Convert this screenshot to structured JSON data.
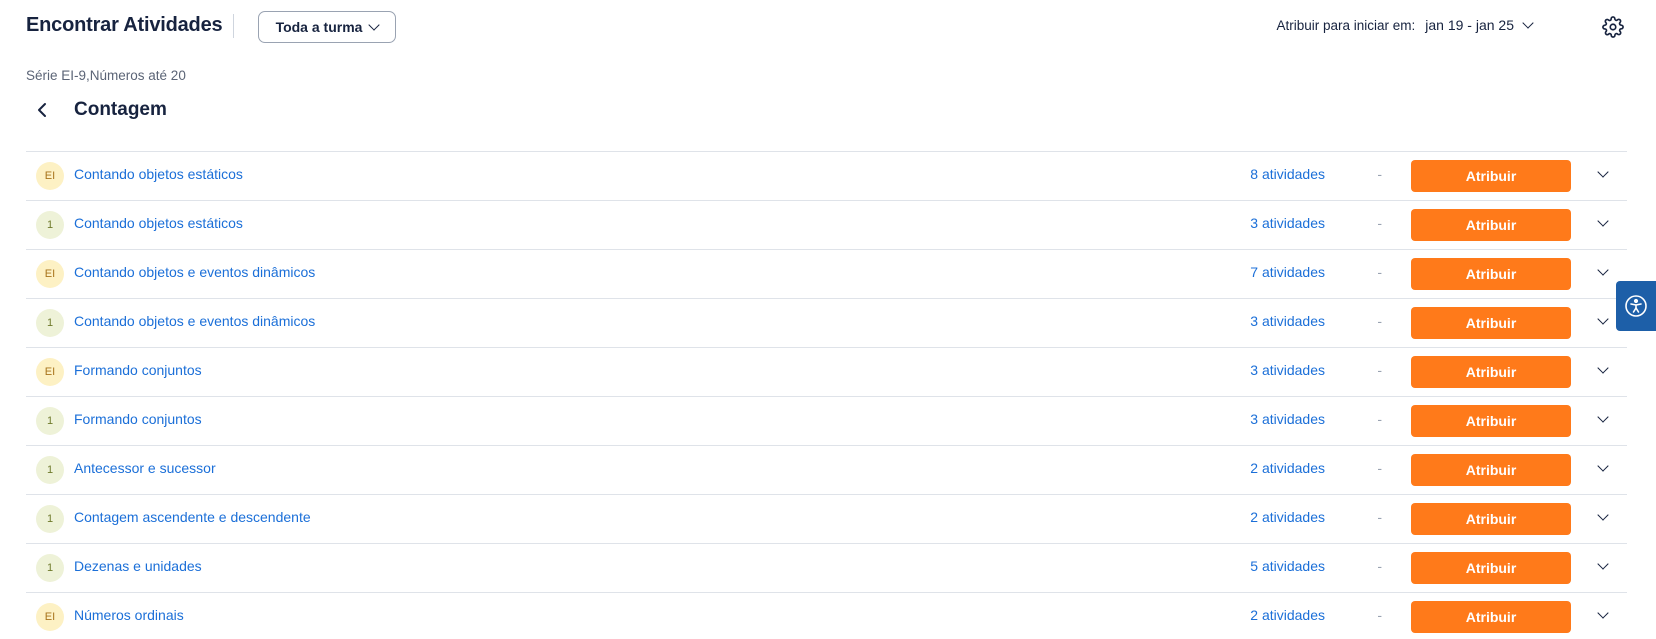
{
  "header": {
    "title": "Encontrar Atividades",
    "class_select": "Toda a turma",
    "assign_start_label": "Atribuir para iniciar em:",
    "date_range": "jan 19 - jan 25"
  },
  "breadcrumb": "Série EI-9,Números até 20",
  "page_title": "Contagem",
  "rows": [
    {
      "level": "EI",
      "title": "Contando objetos estáticos",
      "count": "8 atividades",
      "dash": "-",
      "button": "Atribuir"
    },
    {
      "level": "1",
      "title": "Contando objetos estáticos",
      "count": "3 atividades",
      "dash": "-",
      "button": "Atribuir"
    },
    {
      "level": "EI",
      "title": "Contando objetos e eventos dinâmicos",
      "count": "7 atividades",
      "dash": "-",
      "button": "Atribuir"
    },
    {
      "level": "1",
      "title": "Contando objetos e eventos dinâmicos",
      "count": "3 atividades",
      "dash": "-",
      "button": "Atribuir"
    },
    {
      "level": "EI",
      "title": "Formando conjuntos",
      "count": "3 atividades",
      "dash": "-",
      "button": "Atribuir"
    },
    {
      "level": "1",
      "title": "Formando conjuntos",
      "count": "3 atividades",
      "dash": "-",
      "button": "Atribuir"
    },
    {
      "level": "1",
      "title": "Antecessor e sucessor",
      "count": "2 atividades",
      "dash": "-",
      "button": "Atribuir"
    },
    {
      "level": "1",
      "title": "Contagem ascendente e descendente",
      "count": "2 atividades",
      "dash": "-",
      "button": "Atribuir"
    },
    {
      "level": "1",
      "title": "Dezenas e unidades",
      "count": "5 atividades",
      "dash": "-",
      "button": "Atribuir"
    },
    {
      "level": "EI",
      "title": "Números ordinais",
      "count": "2 atividades",
      "dash": "-",
      "button": "Atribuir"
    }
  ],
  "colors": {
    "accent_orange": "#ff7a1a",
    "link_blue": "#1b6fd8",
    "badge_ei_bg": "#fdf1c4",
    "badge_one_bg": "#eef2d8",
    "a11y_blue": "#1d5fa8"
  },
  "icons": {
    "settings": "gear-icon",
    "back": "chevron-left-icon",
    "expand": "chevron-down-icon",
    "accessibility": "accessibility-icon"
  }
}
